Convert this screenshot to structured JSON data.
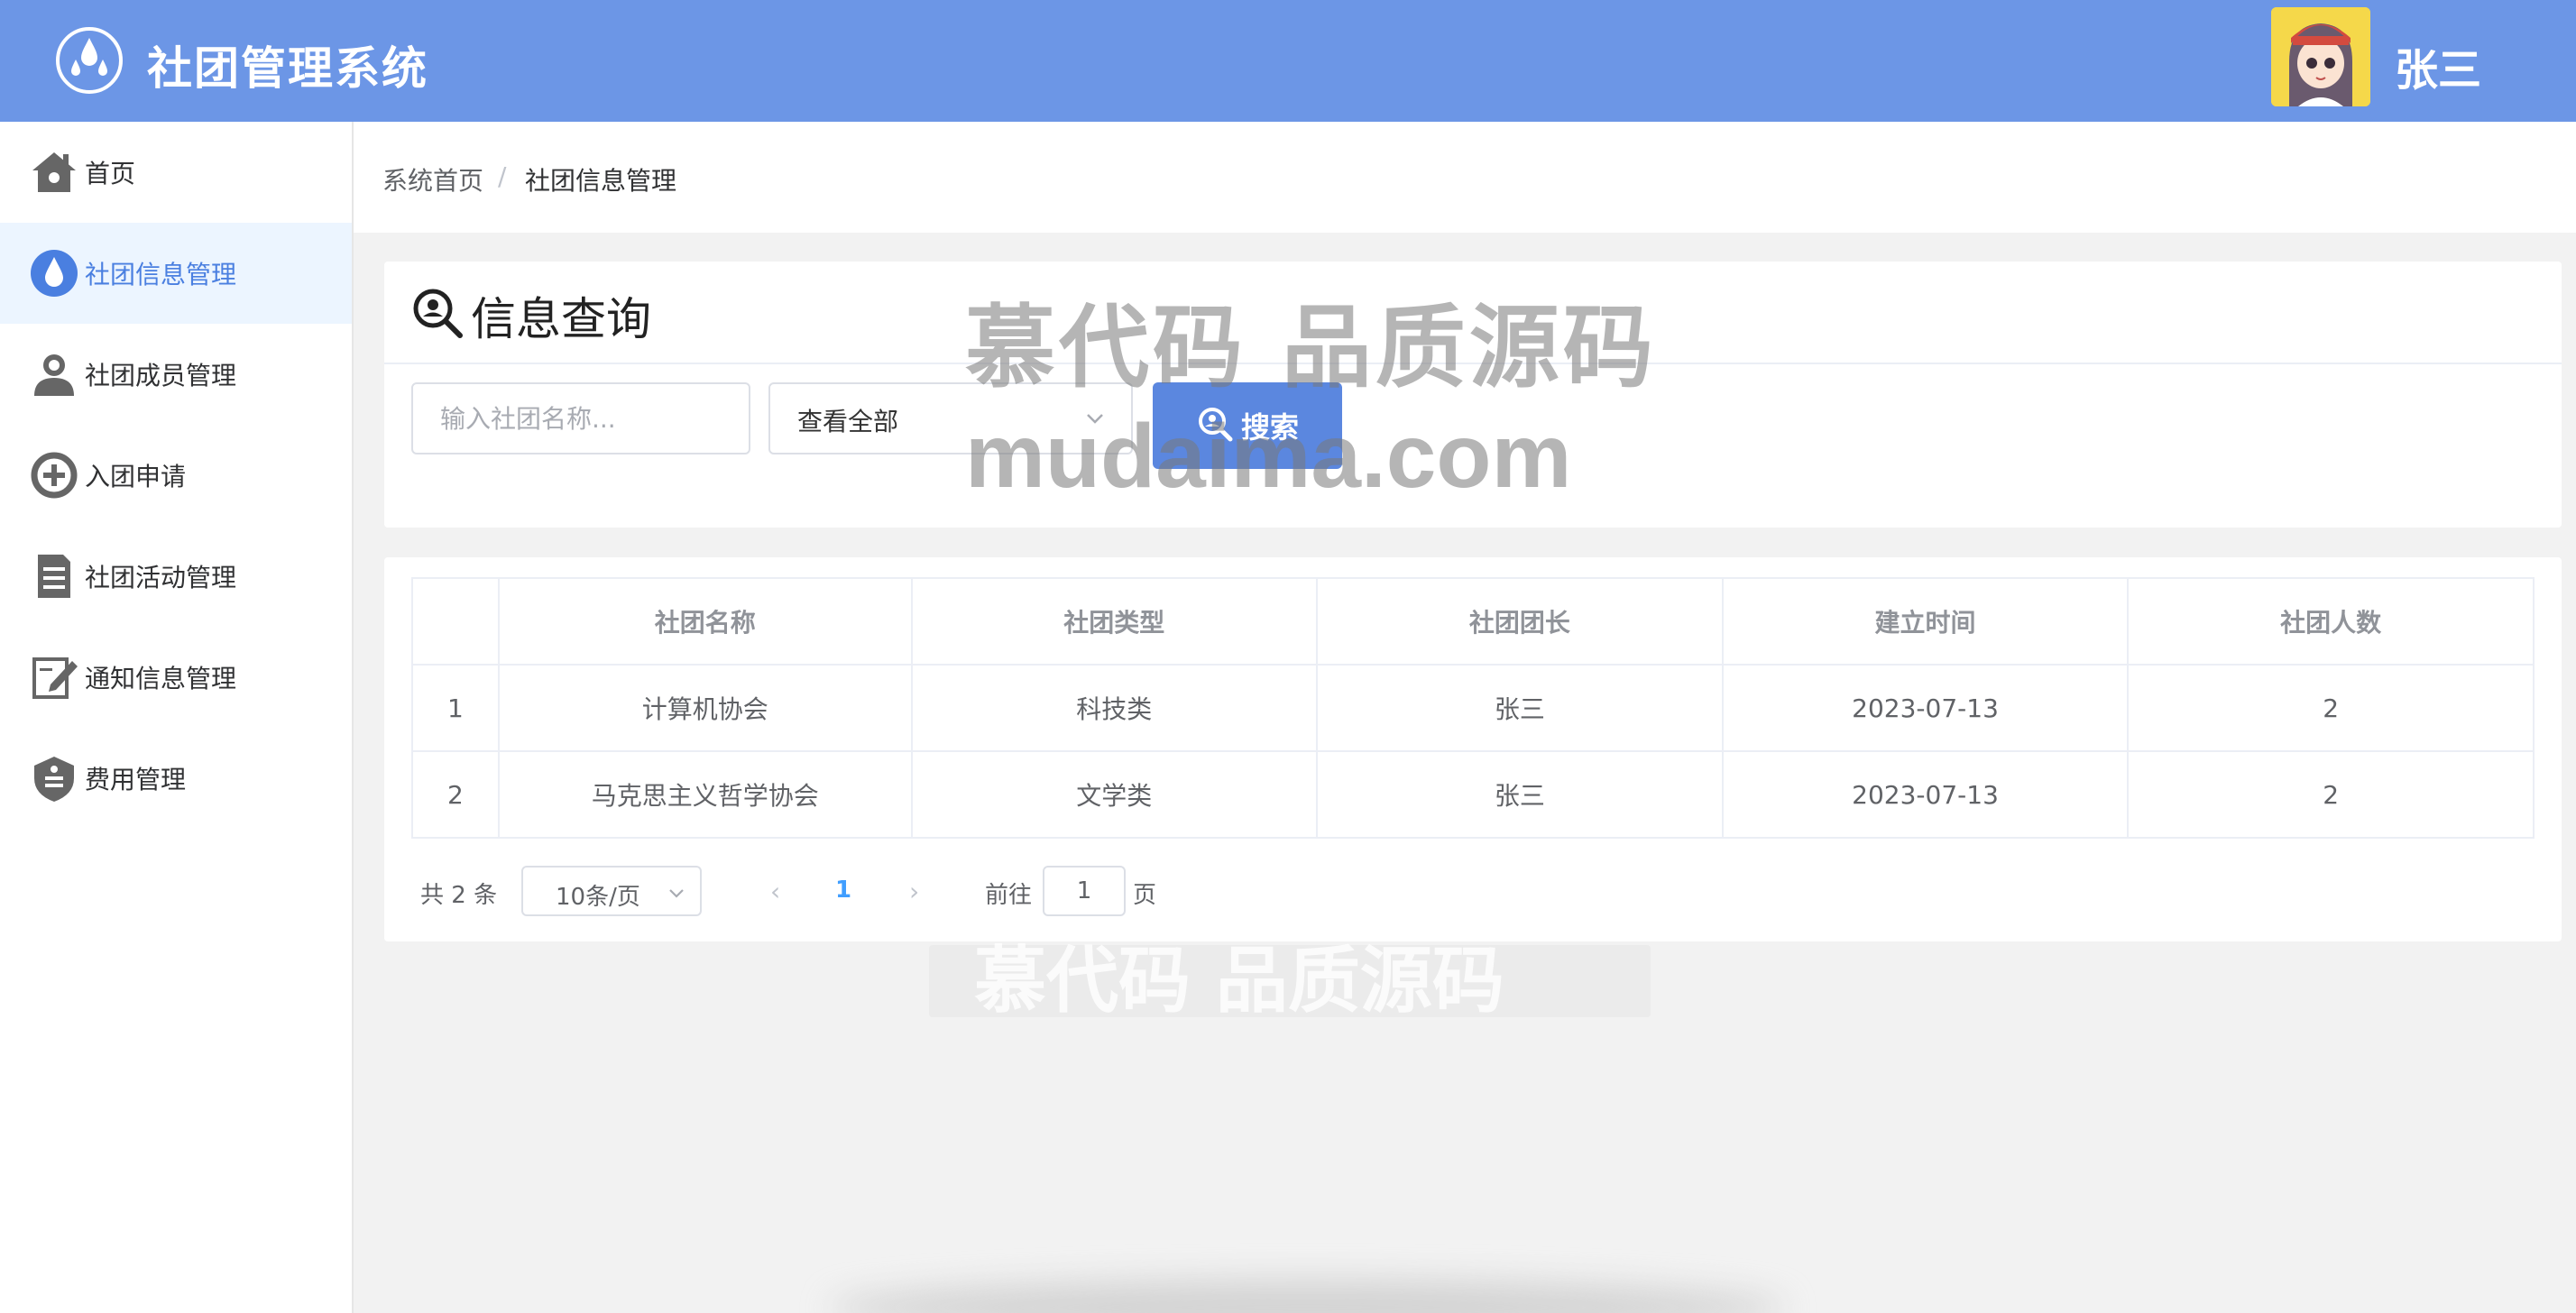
{
  "app": {
    "title": "社团管理系统",
    "user_name": "张三"
  },
  "sidebar": {
    "items": [
      {
        "label": "首页",
        "icon": "home-icon",
        "active": false
      },
      {
        "label": "社团信息管理",
        "icon": "water-drop-icon",
        "active": true
      },
      {
        "label": "社团成员管理",
        "icon": "user-icon",
        "active": false
      },
      {
        "label": "入团申请",
        "icon": "add-circle-icon",
        "active": false
      },
      {
        "label": "社团活动管理",
        "icon": "document-list-icon",
        "active": false
      },
      {
        "label": "通知信息管理",
        "icon": "edit-note-icon",
        "active": false
      },
      {
        "label": "费用管理",
        "icon": "shield-icon",
        "active": false
      }
    ]
  },
  "breadcrumb": {
    "items": [
      "系统首页",
      "社团信息管理"
    ],
    "separator": "/"
  },
  "query": {
    "title": "信息查询",
    "search_placeholder": "输入社团名称...",
    "filter_selected": "查看全部",
    "search_button": "搜索"
  },
  "table": {
    "headers": [
      "",
      "社团名称",
      "社团类型",
      "社团团长",
      "建立时间",
      "社团人数"
    ],
    "rows": [
      [
        "1",
        "计算机协会",
        "科技类",
        "张三",
        "2023-07-13",
        "2"
      ],
      [
        "2",
        "马克思主义哲学协会",
        "文学类",
        "张三",
        "2023-07-13",
        "2"
      ]
    ]
  },
  "pagination": {
    "total_label": "共 2 条",
    "page_size": "10条/页",
    "prev": "‹",
    "current_page": "1",
    "next": "›",
    "goto_label": "前往",
    "goto_value": "1",
    "page_suffix": "页"
  },
  "watermark": {
    "line1": "慕代码 品质源码",
    "line2": "mudaima.com"
  },
  "colors": {
    "header": "#6c96e6",
    "accent": "#409eff",
    "button": "#5b87df",
    "active_bg": "#ecf5ff"
  }
}
